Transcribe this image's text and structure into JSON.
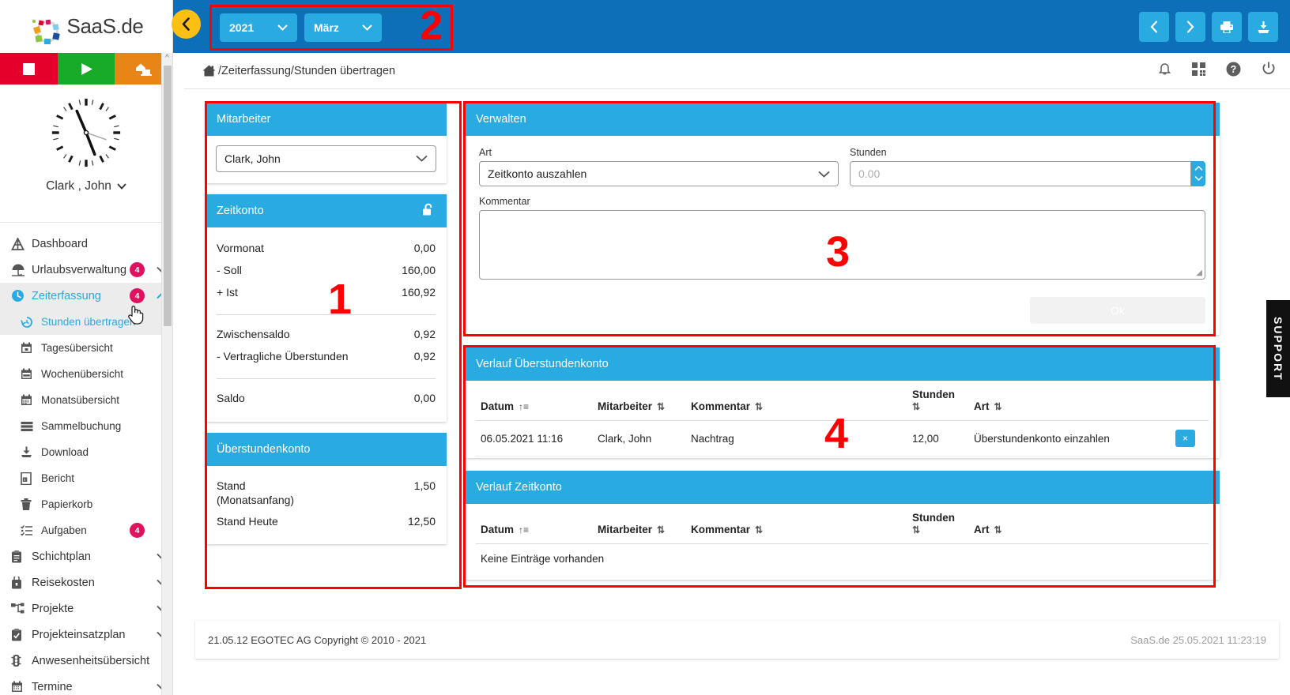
{
  "brand": {
    "name": "SaaS.de"
  },
  "controls": {
    "stop": "stop-square",
    "play": "play-triangle",
    "home_office": "home-office"
  },
  "profile": {
    "name": "Clark , John",
    "chevron": "⌄"
  },
  "sidebar": {
    "items": [
      {
        "label": "Dashboard",
        "icon": "dashboard-icon",
        "badge": "",
        "chevron": ""
      },
      {
        "label": "Urlaubsverwaltung",
        "icon": "umbrella-icon",
        "badge": "4",
        "chevron": "down"
      },
      {
        "label": "Zeiterfassung",
        "icon": "clock-icon",
        "badge": "4",
        "chevron": "up",
        "active": true
      },
      {
        "label": "Stunden übertragen",
        "icon": "history-icon",
        "badge": "",
        "chevron": "",
        "sub": true,
        "active": true
      },
      {
        "label": "Tagesübersicht",
        "icon": "calendar-day-icon",
        "badge": "",
        "chevron": "",
        "sub": true
      },
      {
        "label": "Wochenübersicht",
        "icon": "calendar-week-icon",
        "badge": "",
        "chevron": "",
        "sub": true
      },
      {
        "label": "Monatsübersicht",
        "icon": "calendar-month-icon",
        "badge": "",
        "chevron": "",
        "sub": true
      },
      {
        "label": "Sammelbuchung",
        "icon": "stack-icon",
        "badge": "",
        "chevron": "",
        "sub": true
      },
      {
        "label": "Download",
        "icon": "download-icon",
        "badge": "",
        "chevron": "",
        "sub": true
      },
      {
        "label": "Bericht",
        "icon": "excel-file-icon",
        "badge": "",
        "chevron": "",
        "sub": true
      },
      {
        "label": "Papierkorb",
        "icon": "trash-icon",
        "badge": "",
        "chevron": "",
        "sub": true
      },
      {
        "label": "Aufgaben",
        "icon": "tasklist-icon",
        "badge": "4",
        "chevron": "",
        "sub": true
      },
      {
        "label": "Schichtplan",
        "icon": "clipboard-icon",
        "badge": "",
        "chevron": "down"
      },
      {
        "label": "Reisekosten",
        "icon": "briefcase-icon",
        "badge": "",
        "chevron": "down"
      },
      {
        "label": "Projekte",
        "icon": "sitemap-icon",
        "badge": "",
        "chevron": "down"
      },
      {
        "label": "Projekteinsatzplan",
        "icon": "clipboard-check-icon",
        "badge": "",
        "chevron": "down"
      },
      {
        "label": "Anwesenheitsübersicht",
        "icon": "traffic-light-icon",
        "badge": "",
        "chevron": ""
      },
      {
        "label": "Termine",
        "icon": "calendar-icon",
        "badge": "",
        "chevron": "down"
      }
    ]
  },
  "topbar": {
    "collapse_icon": "chevron-left-icon",
    "year": "2021",
    "month": "März",
    "marker": "2",
    "actions": [
      {
        "name": "prev-period-button",
        "icon": "‹"
      },
      {
        "name": "next-period-button",
        "icon": "›"
      },
      {
        "name": "print-button",
        "icon": "printer"
      },
      {
        "name": "export-button",
        "icon": "download"
      }
    ]
  },
  "breadcrumb": {
    "text": "/Zeiterfassung/Stunden übertragen",
    "home_icon": "home-icon",
    "icons": [
      "bell-icon",
      "grid-icon",
      "help-icon",
      "power-icon"
    ]
  },
  "mitarbeiter": {
    "title": "Mitarbeiter",
    "selected": "Clark, John"
  },
  "zeitkonto": {
    "title": "Zeitkonto",
    "lock_icon": "unlock-icon",
    "rows": [
      {
        "label": "Vormonat",
        "value": "0,00"
      },
      {
        "label": "- Soll",
        "value": "160,00"
      },
      {
        "label": "+ Ist",
        "value": "160,92"
      }
    ],
    "rows2": [
      {
        "label": "Zwischensaldo",
        "value": "0,92"
      },
      {
        "label": "- Vertragliche Überstunden",
        "value": "0,92"
      }
    ],
    "rows3": [
      {
        "label": "Saldo",
        "value": "0,00"
      }
    ],
    "marker": "1"
  },
  "ueberstundenkonto": {
    "title": "Überstundenkonto",
    "rows": [
      {
        "label": "Stand\n(Monatsanfang)",
        "value": "1,50"
      },
      {
        "label": "Stand Heute",
        "value": "12,50"
      }
    ]
  },
  "verwalten": {
    "title": "Verwalten",
    "art_label": "Art",
    "art_value": "Zeitkonto auszahlen",
    "stunden_label": "Stunden",
    "stunden_placeholder": "0.00",
    "kommentar_label": "Kommentar",
    "kommentar_value": "",
    "ok_label": "Ok",
    "marker": "3"
  },
  "verlauf_ueberstunden": {
    "title": "Verlauf Überstundenkonto",
    "columns": [
      "Datum",
      "Mitarbeiter",
      "Kommentar",
      "Stunden",
      "Art"
    ],
    "rows": [
      {
        "datum": "06.05.2021 11:16",
        "mitarbeiter": "Clark, John",
        "kommentar": "Nachtrag",
        "stunden": "12,00",
        "art": "Überstundenkonto einzahlen",
        "delete_icon": "×"
      }
    ],
    "marker": "4"
  },
  "verlauf_zeitkonto": {
    "title": "Verlauf Zeitkonto",
    "columns": [
      "Datum",
      "Mitarbeiter",
      "Kommentar",
      "Stunden",
      "Art"
    ],
    "empty_text": "Keine Einträge vorhanden",
    "rows": []
  },
  "footer": {
    "left": "21.05.12 EGOTEC AG Copyright © 2010 - 2021",
    "right": "SaaS.de  25.05.2021 11:23:19"
  },
  "support": {
    "label": "SUPPORT"
  },
  "colors": {
    "accent": "#29abe2",
    "topbar": "#0d6fb8",
    "badge": "#e0115f",
    "marker": "#ff0000",
    "collapse": "#fcc015"
  }
}
